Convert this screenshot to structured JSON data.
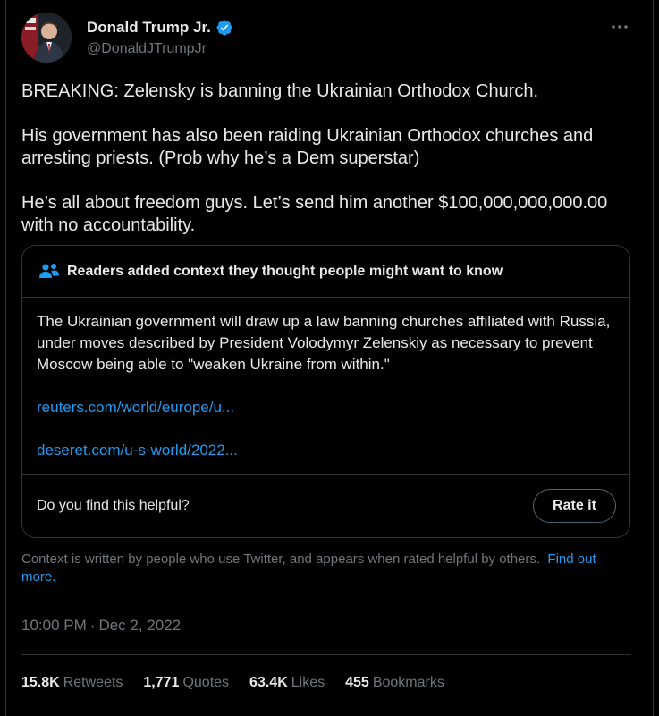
{
  "author": {
    "display_name": "Donald Trump Jr.",
    "handle": "@DonaldJTrumpJr"
  },
  "tweet": {
    "paragraphs": [
      "BREAKING: Zelensky is banning the Ukrainian Orthodox Church.",
      "His government has also been raiding Ukrainian Orthodox churches and arresting priests. (Prob why he’s a Dem superstar)",
      "He’s all about freedom guys. Let’s send him another $100,000,000,000.00 with no accountability."
    ]
  },
  "community_note": {
    "title": "Readers added context they thought people might want to know",
    "body": "The Ukrainian government will draw up a law banning churches affiliated with Russia, under moves described by President Volodymyr Zelenskiy as necessary to prevent Moscow being able to \"weaken Ukraine from within.\"",
    "links": [
      "reuters.com/world/europe/u...",
      "deseret.com/u-s-world/2022..."
    ],
    "helpful_question": "Do you find this helpful?",
    "rate_label": "Rate it"
  },
  "context_footer": {
    "text": "Context is written by people who use Twitter, and appears when rated helpful by others.",
    "link": "Find out more."
  },
  "timestamp": {
    "time": "10:00 PM",
    "separator": "·",
    "date": "Dec 2, 2022"
  },
  "stats": {
    "retweets_count": "15.8K",
    "retweets_label": "Retweets",
    "quotes_count": "1,771",
    "quotes_label": "Quotes",
    "likes_count": "63.4K",
    "likes_label": "Likes",
    "bookmarks_count": "455",
    "bookmarks_label": "Bookmarks"
  },
  "colors": {
    "background": "#000000",
    "text": "#e7e9ea",
    "secondary": "#71767b",
    "link": "#1d9bf0",
    "border": "#2f3336"
  },
  "icons": [
    "verified-badge-icon",
    "more-options-icon",
    "people-icon"
  ]
}
